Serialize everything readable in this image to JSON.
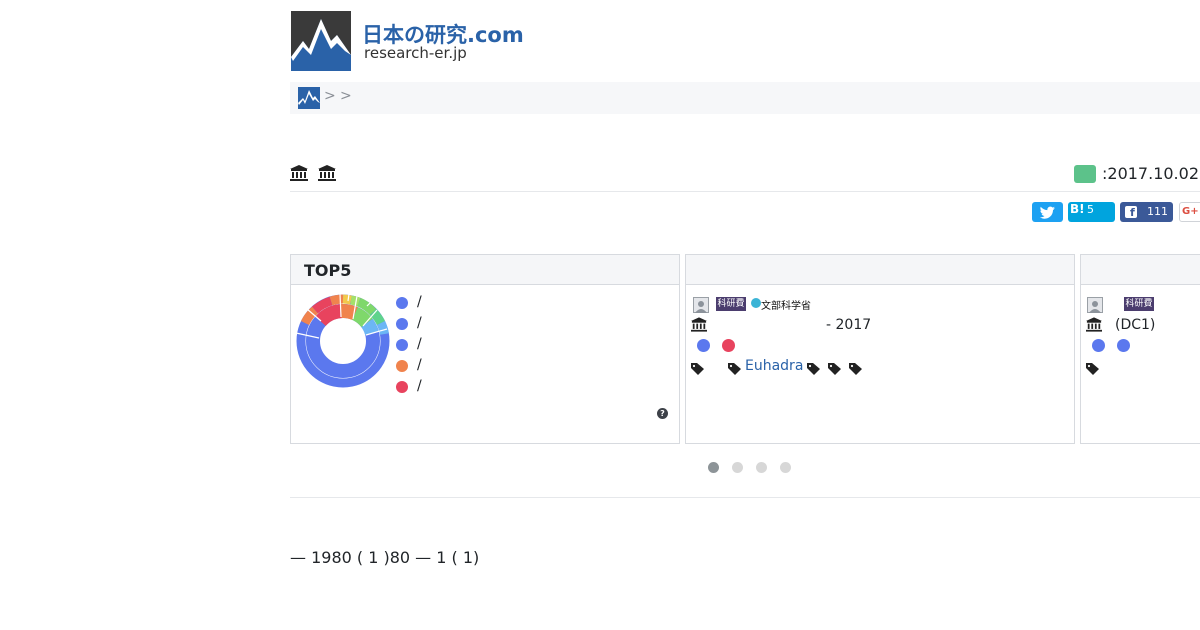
{
  "header": {
    "brand_title": "日本の研究.com",
    "brand_sub": "research-er.jp"
  },
  "breadcrumb": {
    "separators": [
      ">",
      ">"
    ]
  },
  "record": {
    "date": ":2017.10.02",
    "status_color": "#5cc28a"
  },
  "share": {
    "twitter_icon": "twitter-icon",
    "hatena_label": "B!",
    "hatena_count": "5",
    "facebook_count": "111",
    "google_label": "G+"
  },
  "top5": {
    "title": "TOP5",
    "legend": [
      {
        "label": "/",
        "color": "#5b78ee"
      },
      {
        "label": "/",
        "color": "#5b78ee"
      },
      {
        "label": "/",
        "color": "#5b78ee"
      },
      {
        "label": "/",
        "color": "#f0834d"
      },
      {
        "label": "/",
        "color": "#e8435e"
      }
    ]
  },
  "card2": {
    "kaken_label": "科研費",
    "ministry": "文部科学省",
    "period": "- 2017",
    "dot_colors": [
      "#5b78ee",
      "#e8435e"
    ],
    "keyword": "Euhadra"
  },
  "card3": {
    "kaken_label": "科研費",
    "category": "(DC1)",
    "dot_colors": [
      "#5b78ee",
      "#5b78ee"
    ]
  },
  "footer": {
    "period_text": "— 1980 ( 1 )80 — 1 ( 1)"
  }
}
